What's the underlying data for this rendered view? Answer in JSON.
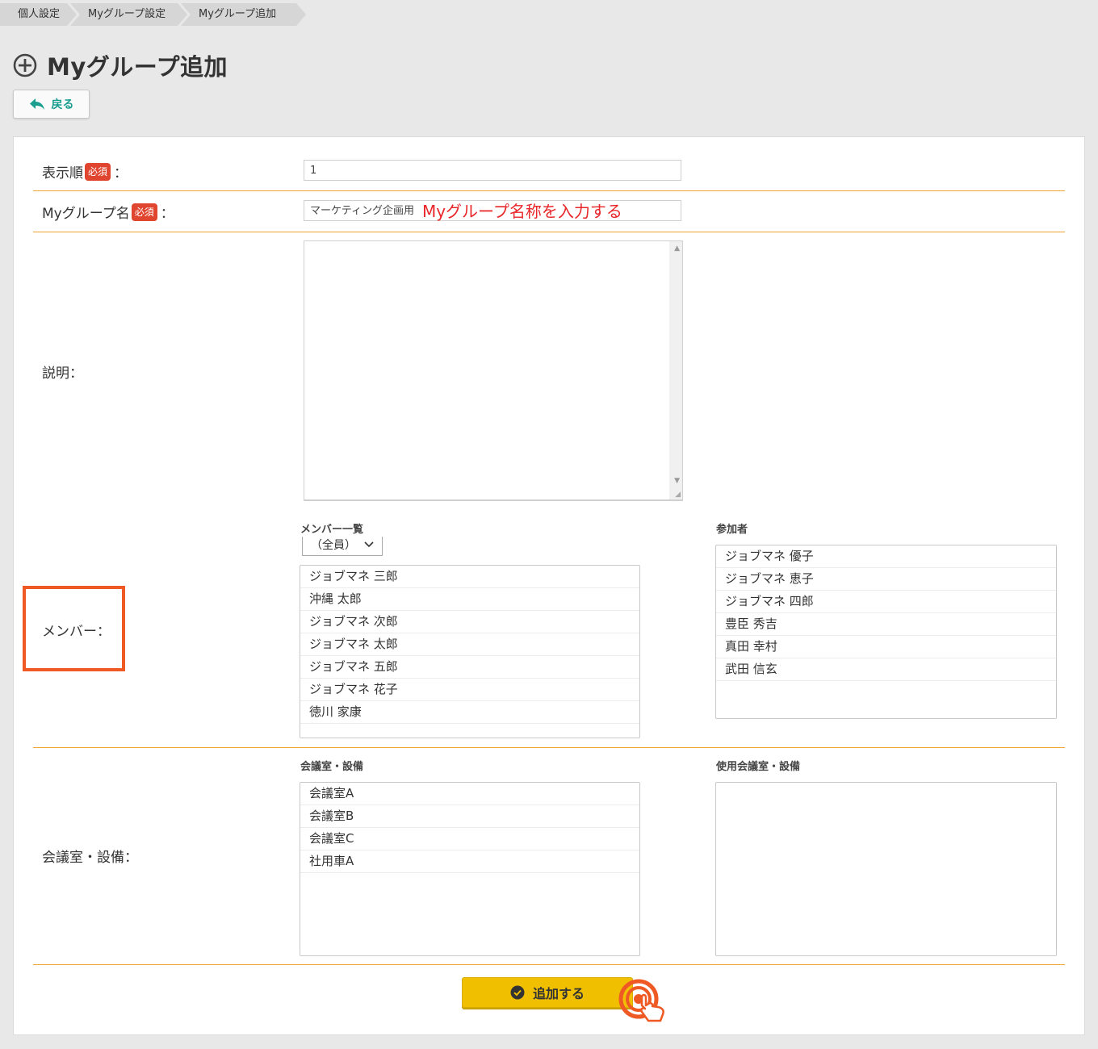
{
  "breadcrumb": [
    "個人設定",
    "Myグループ設定",
    "Myグループ追加"
  ],
  "page": {
    "title": "Myグループ追加",
    "back_label": "戻る"
  },
  "form": {
    "required_badge": "必須",
    "order": {
      "label": "表示順",
      "colon": "：",
      "value": "1"
    },
    "group_name": {
      "label": "Myグループ名",
      "colon": "：",
      "value": "マーケティング企画用",
      "hint": "Myグループ名称を入力する"
    },
    "description": {
      "label": "説明：",
      "value": ""
    },
    "members": {
      "label": "メンバー：",
      "list_title": "メンバー一覧",
      "filter_selected": "（全員）",
      "available": [
        "ジョブマネ 三郎",
        "沖縄 太郎",
        "ジョブマネ 次郎",
        "ジョブマネ 太郎",
        "ジョブマネ 五郎",
        "ジョブマネ 花子",
        "徳川 家康"
      ],
      "selected_title": "参加者",
      "selected": [
        "ジョブマネ 優子",
        "ジョブマネ 恵子",
        "ジョブマネ 四郎",
        "豊臣 秀吉",
        "真田 幸村",
        "武田 信玄"
      ]
    },
    "facilities": {
      "label": "会議室・設備：",
      "list_title": "会議室・設備",
      "available": [
        "会議室A",
        "会議室B",
        "会議室C",
        "社用車A"
      ],
      "selected_title": "使用会議室・設備",
      "selected": []
    },
    "submit_label": "追加する"
  },
  "colors": {
    "accent_line": "#f0a531",
    "required": "#e0452f",
    "submit": "#f0c000",
    "highlight_box": "#ef5a24",
    "back_text": "#1a9e8f",
    "hint_text": "#e8262a"
  }
}
